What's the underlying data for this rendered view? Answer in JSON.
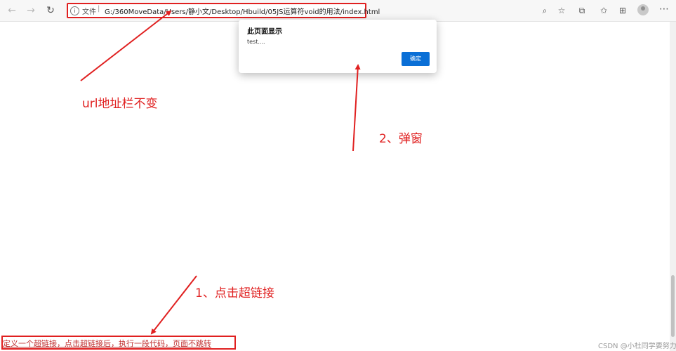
{
  "browser": {
    "address_label": "文件",
    "address_separator": "|",
    "url": "G:/360MoveData/Users/静小文/Desktop/Hbuild/05JS运算符void的用法/index.html"
  },
  "dialog": {
    "title": "此页面显示",
    "message": "test....",
    "ok_label": "确定"
  },
  "annotations": {
    "url_note": "url地址栏不变",
    "popup_note": "2、弹窗",
    "click_note": "1、点击超链接"
  },
  "page": {
    "link_text": "定义一个超链接，点击超链接后，执行一段代码，页面不跳转"
  },
  "watermark": "CSDN @小杜同学要努力",
  "colors": {
    "annotation_red": "#e02020",
    "dialog_button_blue": "#0a6fd6",
    "link_red": "#c03030"
  },
  "icons": {
    "back": "back-arrow-icon",
    "forward": "forward-arrow-icon",
    "refresh": "refresh-icon",
    "info": "info-icon",
    "zoom": "zoom-icon",
    "favorite": "add-favorite-icon",
    "extensions": "extensions-icon",
    "favorites": "favorites-icon",
    "collections": "collections-icon",
    "profile": "profile-avatar-icon",
    "menu": "more-menu-icon"
  }
}
